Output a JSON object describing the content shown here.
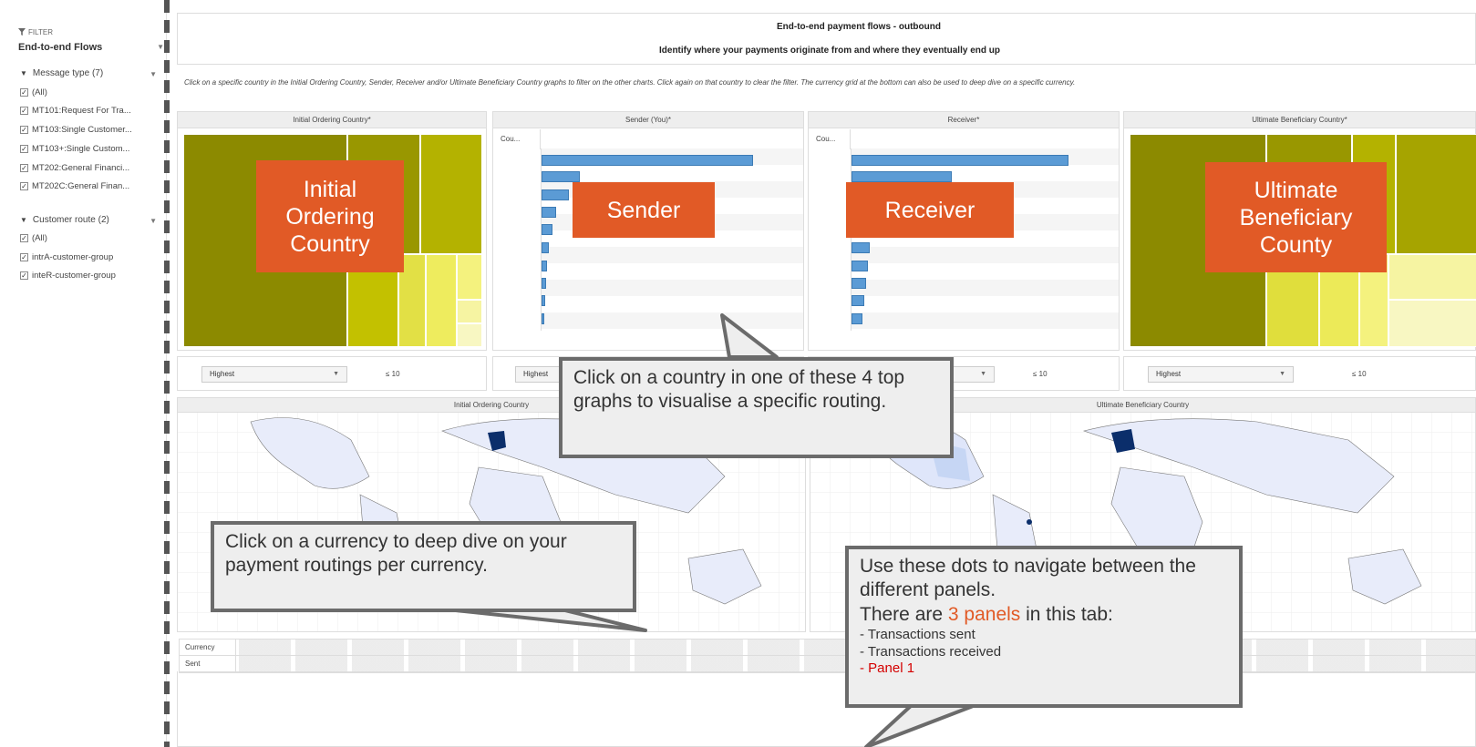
{
  "sidebar": {
    "filter_tab": "FILTER",
    "title": "End-to-end Flows",
    "message_group": "Message type (7)",
    "message_items": [
      "(All)",
      "MT101:Request For Tra...",
      "MT103:Single Customer...",
      "MT103+:Single Custom...",
      "MT202:General Financi...",
      "MT202C:General Finan..."
    ],
    "route_group": "Customer route (2)",
    "route_items": [
      "(All)",
      "intrA-customer-group",
      "inteR-customer-group"
    ]
  },
  "header": {
    "title": "End-to-end payment flows - outbound",
    "subtitle": "Identify where your payments originate from and where they eventually end up"
  },
  "instructions": "Click on a specific country in the Initial Ordering Country, Sender, Receiver and/or Ultimate Beneficiary Country graphs to filter on the other charts. Click again on that country to clear the filter. The currency grid at the bottom can also be used to deep dive on a specific currency.",
  "panels": {
    "p1": "Initial Ordering Country*",
    "p2": "Sender (You)*",
    "p3": "Receiver*",
    "p4": "Ultimate Beneficiary Country*",
    "cou": "Cou..."
  },
  "dropdowns": {
    "highest": "Highest",
    "le10": "≤ 10"
  },
  "maps": {
    "left": "Initial Ordering Country",
    "right": "Ultimate Beneficiary Country"
  },
  "currency": {
    "header": "Currency",
    "row": "Sent"
  },
  "overlays": {
    "initial": "Initial Ordering Country",
    "sender": "Sender",
    "receiver": "Receiver",
    "ultimate": "Ultimate Beneficiary County"
  },
  "callouts": {
    "country": "Click on a country in one of these 4 top graphs to visualise a specific routing.",
    "currency": "Click on a currency to deep dive on your payment routings per currency.",
    "dots_1": "Use these dots to navigate between the different panels.",
    "dots_2a": "There are ",
    "dots_2b": "3 panels",
    "dots_2c": " in this tab:",
    "items": [
      "Transactions sent",
      "Transactions received",
      "Panel 1"
    ]
  },
  "colors": {
    "orange": "#e15a26",
    "bar_blue": "#5b9bd5",
    "olive": "#8c8a00"
  }
}
